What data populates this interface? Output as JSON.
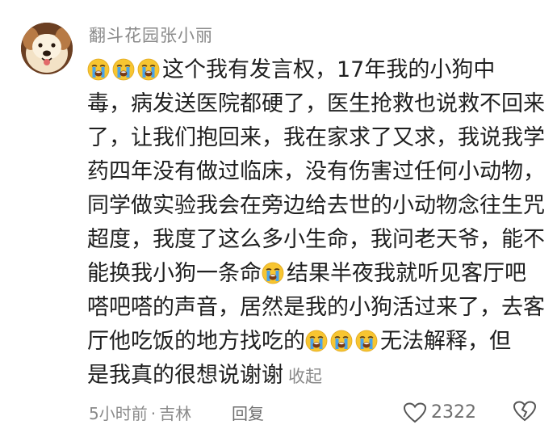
{
  "comment": {
    "username": "翻斗花园张小丽",
    "lines": [
      {
        "emoji_count": 3,
        "text": "这个我有发言权，17年我的小狗中"
      },
      {
        "text": "毒，病发送医院都硬了，医生抢救也说救不回来"
      },
      {
        "text": "了，让我们抱回来，我在家求了又求，我说我学"
      },
      {
        "text": "药四年没有做过临床，没有伤害过任何小动物，"
      },
      {
        "text": "同学做实验我会在旁边给去世的小动物念往生咒"
      },
      {
        "text": "超度，我度了这么多小生命，我问老天爷，能不"
      },
      {
        "text_before": "能换我小狗一条命",
        "text_after": "结果半夜我就听见客厅吧"
      },
      {
        "text": "嗒吧嗒的声音，居然是我的小狗活过来了，去客"
      },
      {
        "text_before": "厅他吃饭的地方找吃的",
        "text_after": "无法解释，但"
      },
      {
        "text": "是我真的很想说谢谢"
      }
    ],
    "collapse_label": "收起",
    "emoji": "loudly-crying-face-icon"
  },
  "meta": {
    "time": "5小时前",
    "separator": "·",
    "location": "吉林",
    "reply_label": "回复",
    "like_count": "2322"
  },
  "colors": {
    "text": "#1f1f1f",
    "secondary": "#8a8a8a",
    "emoji_face": "#f7c531",
    "emoji_tears": "#4aa3e8"
  }
}
